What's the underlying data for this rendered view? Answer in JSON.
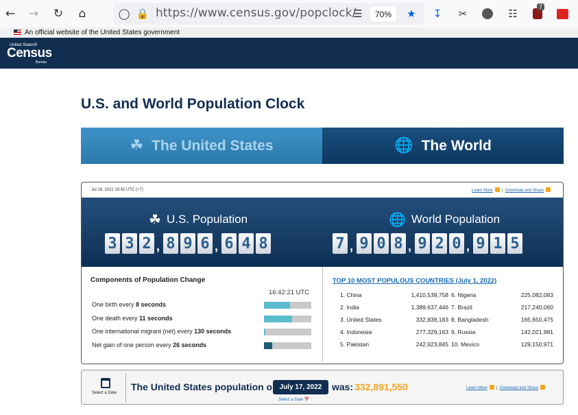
{
  "browser": {
    "url": "https://www.census.gov/popclock/",
    "zoom": "70%",
    "notification_count": "7"
  },
  "banner": {
    "official_text": "An official website of the United States government"
  },
  "logo": {
    "small": "United States®",
    "big": "Census",
    "bureau": "Bureau"
  },
  "page": {
    "title": "U.S. and World Population Clock"
  },
  "tabs": [
    {
      "label": "The United States",
      "icon": "us-map-icon"
    },
    {
      "label": "The World",
      "icon": "globe-icon"
    }
  ],
  "panel": {
    "timestamp": "Jul 18, 2022 16:42 UTC (+7)",
    "learn_more": "Learn More",
    "download_share": "Download and Share",
    "us_label": "U.S. Population",
    "world_label": "World Population",
    "us_digits": [
      "3",
      "3",
      "2",
      "8",
      "9",
      "6",
      "6",
      "4",
      "8"
    ],
    "world_digits": [
      "7",
      "9",
      "0",
      "8",
      "9",
      "2",
      "0",
      "9",
      "1",
      "5"
    ]
  },
  "components": {
    "title": "Components of Population Change",
    "time": "16:42:21 UTC",
    "rows": [
      {
        "text": "One birth every ",
        "value": "8 seconds",
        "fill": 0.55,
        "color": "#5bbccd"
      },
      {
        "text": "One death every ",
        "value": "11 seconds",
        "fill": 0.6,
        "color": "#5bbccd"
      },
      {
        "text": "One international migrant (net) every ",
        "value": "130 seconds",
        "fill": 0.03,
        "color": "#5bbccd"
      },
      {
        "text": "Net gain of one person every ",
        "value": "26 seconds",
        "fill": 0.17,
        "color": "#1b5b6e"
      }
    ]
  },
  "top10": {
    "title": "TOP 10 MOST POPULOUS COUNTRIES (July 1, 2022)",
    "left": [
      {
        "name": "1. China",
        "value": "1,410,539,758"
      },
      {
        "name": "2. India",
        "value": "1,389,637,446"
      },
      {
        "name": "3. United States",
        "value": "332,838,183"
      },
      {
        "name": "4. Indonesia",
        "value": "277,329,163"
      },
      {
        "name": "5. Pakistan",
        "value": "242,923,845"
      }
    ],
    "right": [
      {
        "name": "6. Nigeria",
        "value": "225,082,083"
      },
      {
        "name": "7. Brazil",
        "value": "217,240,060"
      },
      {
        "name": "8. Bangladesh",
        "value": "165,650,475"
      },
      {
        "name": "9. Russia",
        "value": "142,021,981"
      },
      {
        "name": "10. Mexico",
        "value": "129,150,971"
      }
    ]
  },
  "bottom": {
    "select_date": "Select a Date",
    "prefix": "The United States population on",
    "date": "July 17, 2022",
    "was": "was:",
    "value": "332,891,550",
    "select_date_small": "Select a Date",
    "learn_more": "Learn More",
    "download_share": "Download and Share"
  }
}
